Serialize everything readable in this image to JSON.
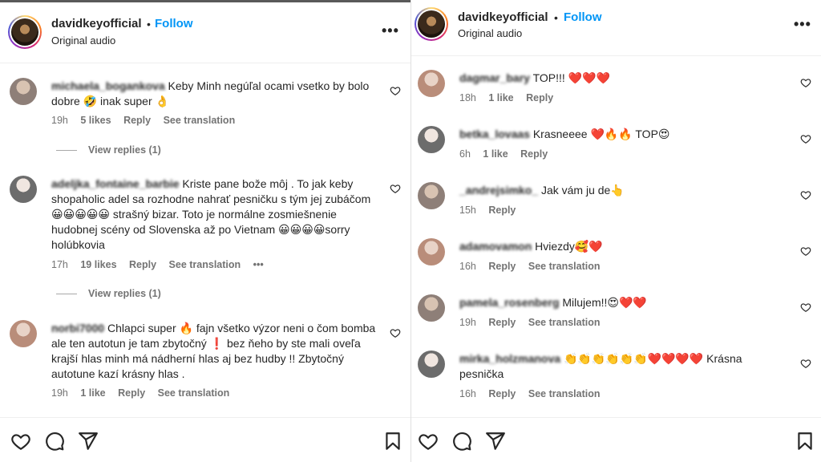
{
  "left": {
    "header": {
      "username": "davidkeyofficial",
      "dot": "•",
      "follow": "Follow",
      "audio": "Original audio",
      "more": "•••"
    },
    "comments": [
      {
        "user": "michaela_bogankova",
        "text": "Keby Minh negúľal ocami vsetko by bolo dobre 🤣 inak super 👌",
        "time": "19h",
        "likes": "5 likes",
        "reply": "Reply",
        "translate": "See translation",
        "replies": "View replies (1)"
      },
      {
        "user": "adeljka_fontaine_barbie",
        "text": "Kriste pane bože môj . To jak keby shopaholic adel sa rozhodne nahrať pesničku s tým jej zubáčom 😀😀😀😀😀 strašný bizar. Toto je normálne zosmiešnenie hudobnej scény od Slovenska až po Vietnam 😀😀😀😀sorry holúbkovia",
        "time": "17h",
        "likes": "19 likes",
        "reply": "Reply",
        "translate": "See translation",
        "more": "•••",
        "replies": "View replies (1)"
      },
      {
        "user": "norbi7000",
        "text": "Chlapci super 🔥 fajn všetko výzor neni o čom bomba ale ten autotun je tam zbytočný ❗ bez ňeho by ste mali oveľa krajší hlas minh má nádherní hlas aj bez hudby !! Zbytočný autotune kazí krásny hlas .",
        "time": "19h",
        "likes": "1 like",
        "reply": "Reply",
        "translate": "See translation"
      }
    ]
  },
  "right": {
    "header": {
      "username": "davidkeyofficial",
      "dot": "•",
      "follow": "Follow",
      "audio": "Original audio",
      "more": "•••"
    },
    "comments": [
      {
        "user": "dagmar_bary",
        "text": "TOP!!! ❤️❤️❤️",
        "time": "18h",
        "likes": "1 like",
        "reply": "Reply"
      },
      {
        "user": "betka_lovaas",
        "text": "Krasneeee ❤️🔥🔥 TOP😍",
        "time": "6h",
        "likes": "1 like",
        "reply": "Reply"
      },
      {
        "user": "_andrejsimko_",
        "text": "Jak vám ju de👆",
        "time": "15h",
        "reply": "Reply"
      },
      {
        "user": "adamovamon",
        "text": "Hviezdy🥰❤️",
        "time": "16h",
        "reply": "Reply",
        "translate": "See translation"
      },
      {
        "user": "pamela_rosenberg",
        "text": "Milujem!!😍❤️❤️",
        "time": "19h",
        "reply": "Reply",
        "translate": "See translation"
      },
      {
        "user": "mirka_holzmanova",
        "text": "👏👏👏👏👏👏❤️❤️❤️❤️ Krásna pesnička",
        "time": "16h",
        "reply": "Reply",
        "translate": "See translation"
      }
    ]
  },
  "icons": {
    "like": "heart-icon",
    "comment": "comment-icon",
    "share": "share-icon",
    "save": "bookmark-icon"
  }
}
